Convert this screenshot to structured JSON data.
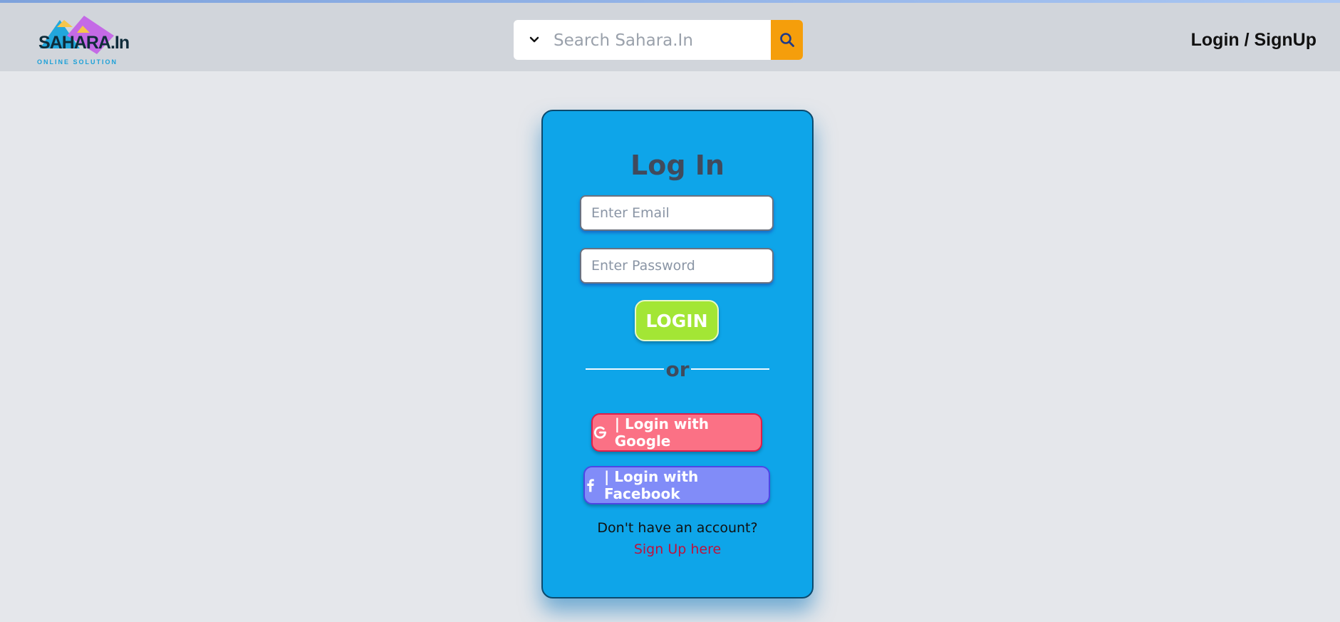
{
  "header": {
    "logo": {
      "name": "SAHARA.In",
      "tagline": "ONLINE SOLUTION"
    },
    "search": {
      "placeholder": "Search Sahara.In",
      "value": ""
    },
    "nav_login": "Login / SignUp"
  },
  "login_card": {
    "title": "Log In",
    "email_placeholder": "Enter Email",
    "password_placeholder": "Enter Password",
    "login_label": "LOGIN",
    "divider_text": "or",
    "google_label": "| Login with Google",
    "facebook_label": "| Login with Facebook",
    "no_account_text": "Don't have an account?",
    "signup_link": "Sign Up here"
  },
  "colors": {
    "card": "#0ea5e9",
    "login_button": "#a3e635",
    "google_button": "#fb7185",
    "facebook_button": "#818cf8",
    "search_button": "#f59e0b",
    "signup_link": "#be123c"
  },
  "icons": {
    "search_dropdown": "chevron-down-icon",
    "search_button": "search-icon",
    "google": "google-icon",
    "facebook": "facebook-icon"
  }
}
